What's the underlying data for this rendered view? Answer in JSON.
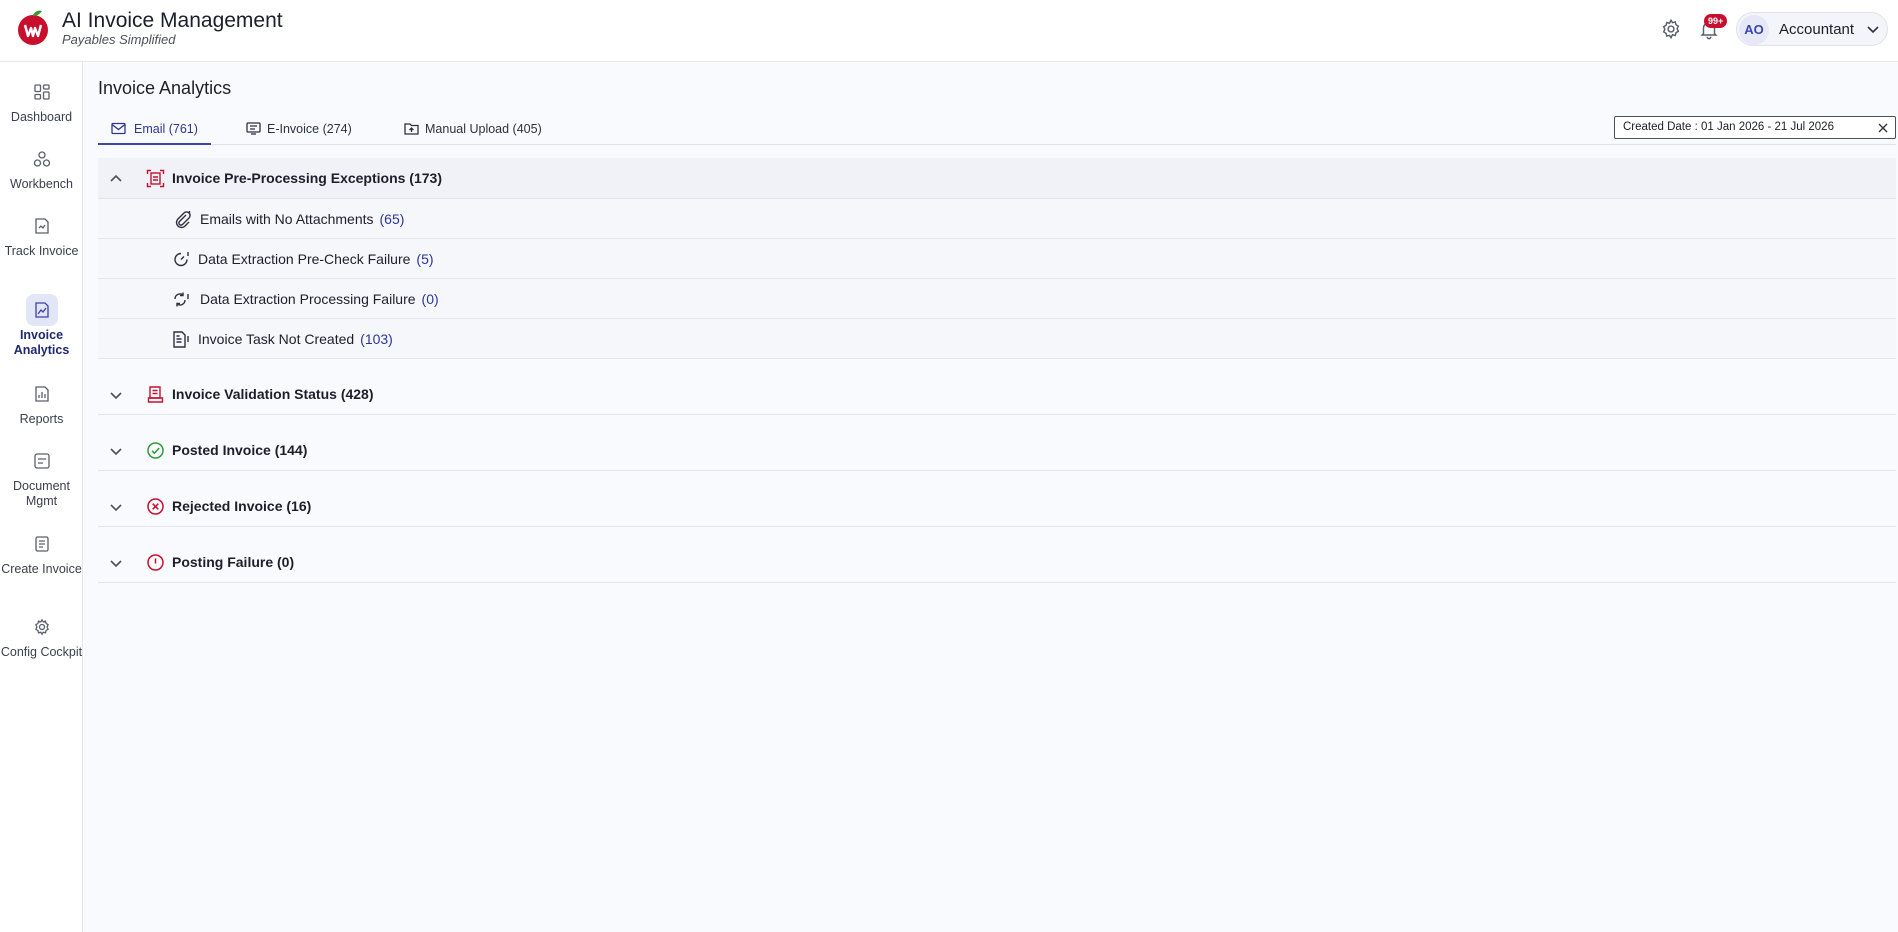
{
  "app": {
    "title": "AI Invoice Management",
    "subtitle": "Payables Simplified",
    "notifications_badge": "99+",
    "user_initials": "AO",
    "user_role": "Accountant",
    "brand_color": "#c8102e",
    "accent_color": "#3b44a8"
  },
  "sidebar": {
    "items": [
      {
        "label": "Dashboard",
        "icon": "dashboard-icon"
      },
      {
        "label": "Workbench",
        "icon": "workbench-icon"
      },
      {
        "label": "Track Invoice",
        "icon": "track-invoice-icon"
      },
      {
        "label": "Invoice Analytics",
        "icon": "analytics-icon",
        "active": true
      },
      {
        "label": "Reports",
        "icon": "reports-icon"
      },
      {
        "label": "Document Mgmt",
        "icon": "document-icon"
      },
      {
        "label": "Create Invoice",
        "icon": "create-invoice-icon"
      },
      {
        "label": "Config Cockpit",
        "icon": "config-icon"
      }
    ]
  },
  "page": {
    "title": "Invoice Analytics",
    "tabs": [
      {
        "label": "Email (761)",
        "active": true
      },
      {
        "label": "E-Invoice (274)"
      },
      {
        "label": "Manual Upload (405)"
      }
    ],
    "date_filter": "Created Date : 01 Jan 2026 - 21 Jul 2026"
  },
  "sections": [
    {
      "title": "Invoice Pre-Processing Exceptions (173)",
      "expanded": true,
      "items": [
        {
          "label": "Emails with No Attachments",
          "count": "(65)"
        },
        {
          "label": "Data Extraction Pre-Check Failure",
          "count": "(5)"
        },
        {
          "label": "Data Extraction Processing Failure",
          "count": "(0)"
        },
        {
          "label": "Invoice Task Not Created",
          "count": "(103)"
        }
      ]
    },
    {
      "title": "Invoice Validation Status (428)",
      "expanded": false
    },
    {
      "title": "Posted Invoice (144)",
      "expanded": false
    },
    {
      "title": "Rejected Invoice (16)",
      "expanded": false
    },
    {
      "title": "Posting Failure (0)",
      "expanded": false
    }
  ]
}
